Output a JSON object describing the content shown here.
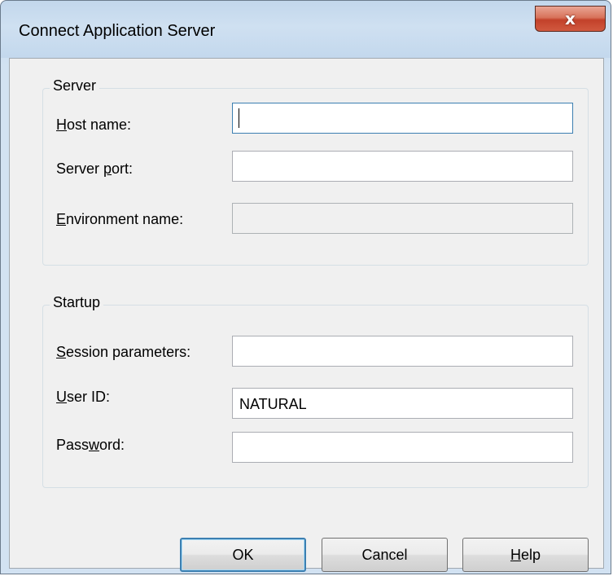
{
  "window": {
    "title": "Connect Application Server",
    "close_glyph": "x"
  },
  "server_group": {
    "label": "Server",
    "host_name": {
      "label_mnemonic": "H",
      "label_rest": "ost name:",
      "value": ""
    },
    "server_port": {
      "label_pre": "Server ",
      "label_mnemonic": "p",
      "label_rest": "ort:",
      "value": ""
    },
    "environment_name": {
      "label_mnemonic": "E",
      "label_rest": "nvironment name:",
      "value": ""
    }
  },
  "startup_group": {
    "label": "Startup",
    "session_parameters": {
      "label_mnemonic": "S",
      "label_rest": "ession parameters:",
      "value": ""
    },
    "user_id": {
      "label_mnemonic": "U",
      "label_rest": "ser ID:",
      "value": "NATURAL"
    },
    "password": {
      "label_pre": "Pass",
      "label_mnemonic": "w",
      "label_rest": "ord:",
      "value": ""
    }
  },
  "buttons": {
    "ok": "OK",
    "cancel": "Cancel",
    "help_mnemonic": "H",
    "help_rest": "elp"
  },
  "icons": {
    "close": "close-icon"
  },
  "colors": {
    "focus_border": "#3c7fb1",
    "close_button": "#c2412a",
    "client_background": "#f0f0f0"
  }
}
